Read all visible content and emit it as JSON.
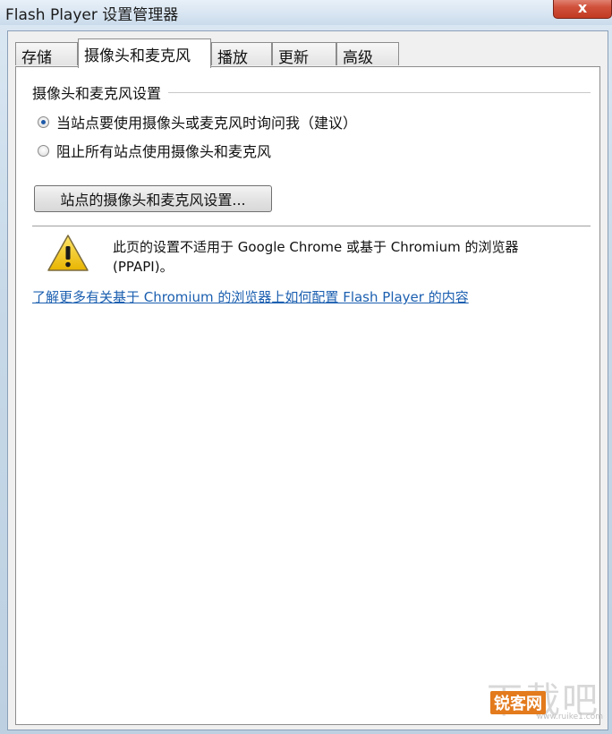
{
  "window": {
    "title": "Flash Player 设置管理器",
    "close_label": "x"
  },
  "tabs": [
    {
      "label": "存储"
    },
    {
      "label": "摄像头和麦克风"
    },
    {
      "label": "播放"
    },
    {
      "label": "更新"
    },
    {
      "label": "高级"
    }
  ],
  "active_tab": "摄像头和麦克风",
  "camera_settings": {
    "group_title": "摄像头和麦克风设置",
    "options": [
      {
        "label": "当站点要使用摄像头或麦克风时询问我（建议）",
        "checked": true
      },
      {
        "label": "阻止所有站点使用摄像头和麦克风",
        "checked": false
      }
    ],
    "site_settings_button": "站点的摄像头和麦克风设置..."
  },
  "notice": {
    "icon": "warning-icon",
    "text": "此页的设置不适用于 Google Chrome 或基于 Chromium 的浏览器 (PPAPI)。",
    "link": "了解更多有关基于 Chromium 的浏览器上如何配置 Flash Player 的内容"
  },
  "watermark": {
    "big": "下载吧",
    "badge": "锐客网",
    "sub": "www.ruike1.com"
  },
  "colors": {
    "link": "#1b5fb0",
    "close_button": "#c23a22",
    "radio_dot": "#1f5aa8"
  }
}
